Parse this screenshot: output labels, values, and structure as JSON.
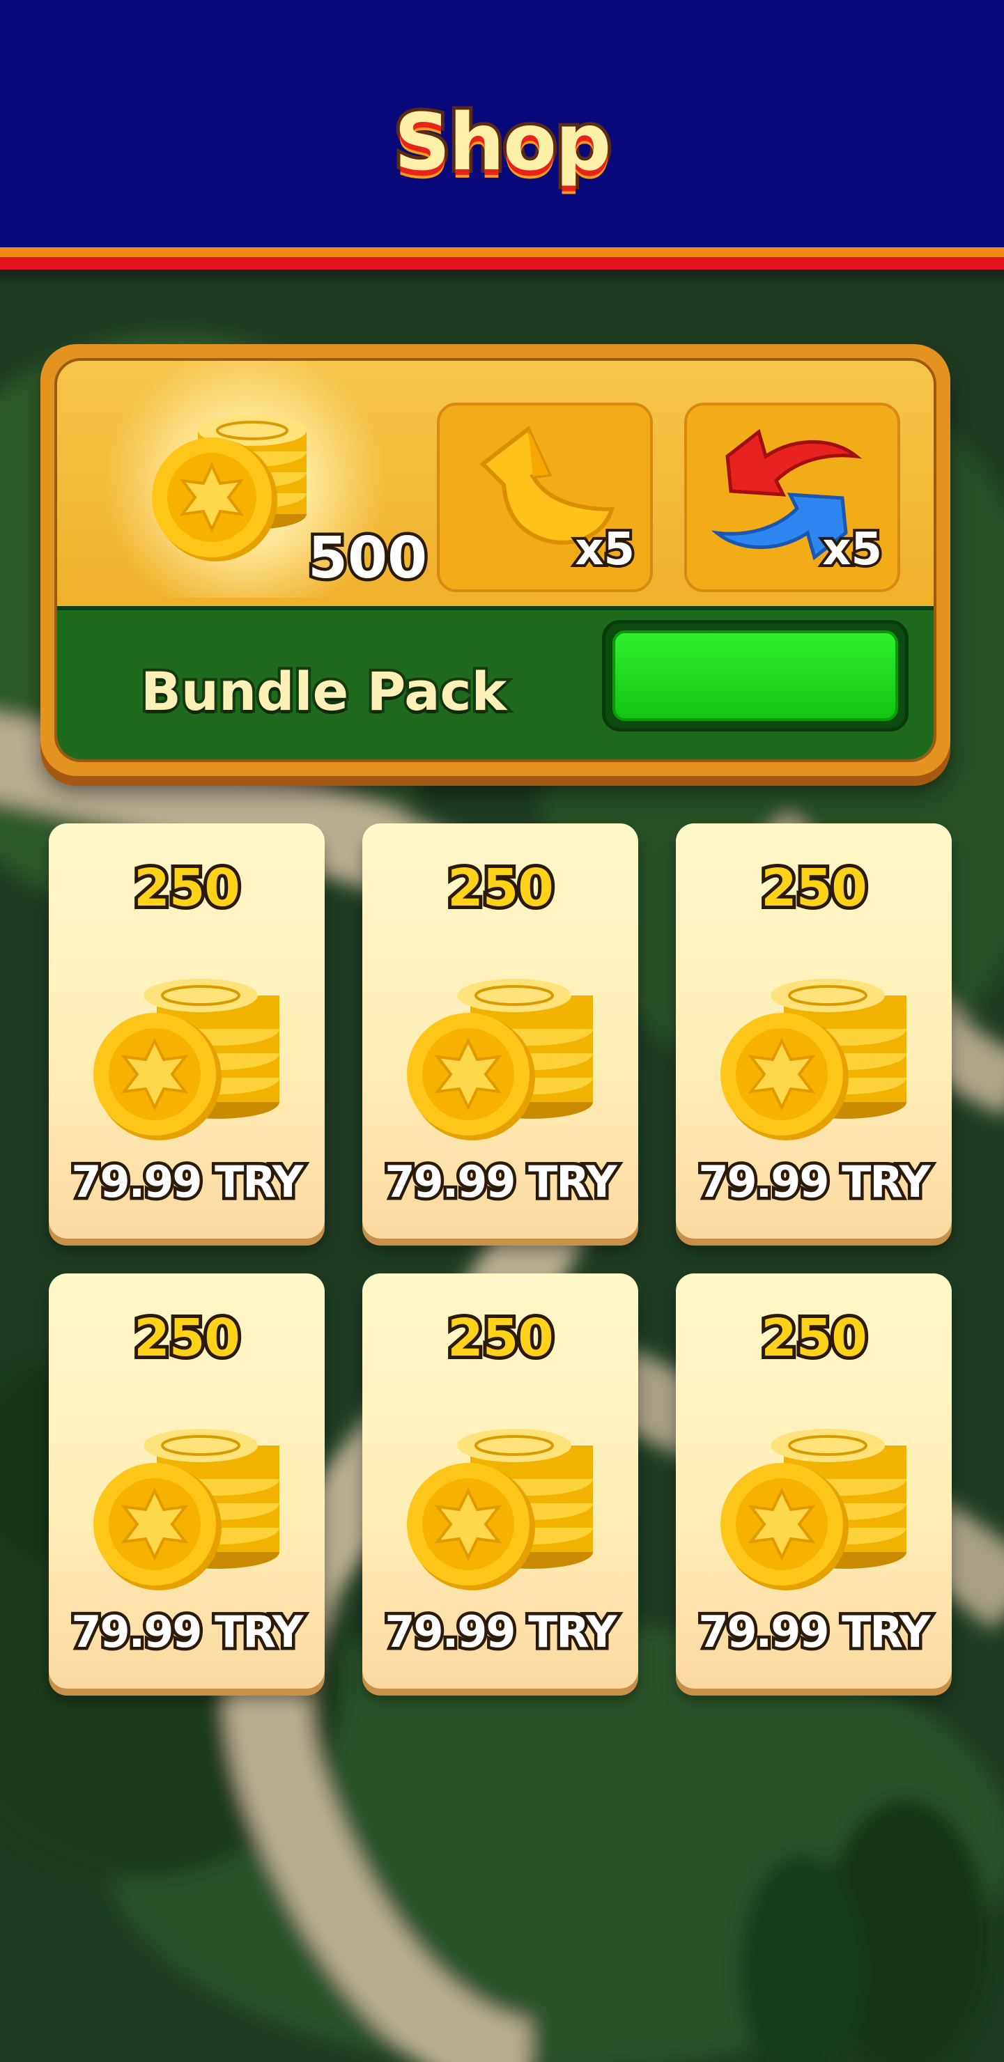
{
  "header": {
    "title": "Shop"
  },
  "bundle": {
    "coin_amount": "500",
    "items": [
      {
        "icon": "undo-arrow-icon",
        "qty": "x5"
      },
      {
        "icon": "shuffle-arrows-icon",
        "qty": "x5"
      }
    ],
    "label": "Bundle Pack",
    "buy_button_label": ""
  },
  "offers": [
    {
      "amount": "250",
      "price": "79.99 TRY",
      "icon": "coin-stack-icon"
    },
    {
      "amount": "250",
      "price": "79.99 TRY",
      "icon": "coin-stack-icon"
    },
    {
      "amount": "250",
      "price": "79.99 TRY",
      "icon": "coin-stack-icon"
    },
    {
      "amount": "250",
      "price": "79.99 TRY",
      "icon": "coin-stack-icon"
    },
    {
      "amount": "250",
      "price": "79.99 TRY",
      "icon": "coin-stack-icon"
    },
    {
      "amount": "250",
      "price": "79.99 TRY",
      "icon": "coin-stack-icon"
    }
  ],
  "colors": {
    "header": "#08097a",
    "bundle_frame": "#e49220",
    "bundle_label_bar": "#1f6b1e",
    "buy_button": "#2eef2e",
    "coin": "#f6b800"
  }
}
